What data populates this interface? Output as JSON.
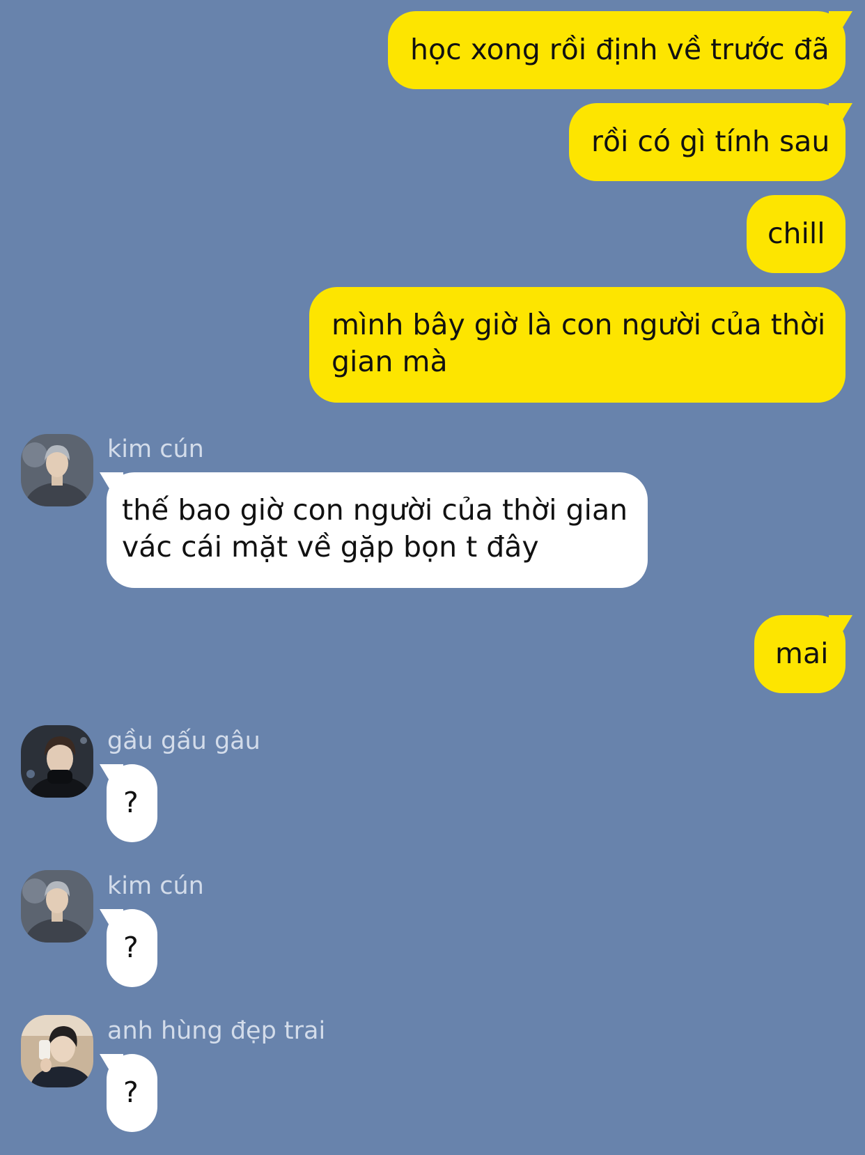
{
  "colors": {
    "background": "#6883ac",
    "outgoing_bubble": "#fde500",
    "incoming_bubble": "#ffffff",
    "sender_name": "#d3dcea"
  },
  "outgoing": [
    {
      "lines": [
        "học xong rồi định về trước đã"
      ]
    },
    {
      "lines": [
        "rồi có gì tính sau"
      ]
    },
    {
      "lines": [
        "chill"
      ]
    },
    {
      "lines": [
        "mình bây giờ là con người của thời",
        "gian mà"
      ]
    },
    {
      "lines": [
        "mai"
      ]
    }
  ],
  "incoming": [
    {
      "sender": "kim cún",
      "avatar_icon": "avatar-photo-icon",
      "lines": [
        "thế bao giờ con người của thời gian",
        "vác cái mặt về gặp bọn t đây"
      ]
    },
    {
      "sender": "gầu gấu gâu",
      "avatar_icon": "avatar-photo-icon",
      "lines": [
        "?"
      ]
    },
    {
      "sender": "kim cún",
      "avatar_icon": "avatar-photo-icon",
      "lines": [
        "?"
      ]
    },
    {
      "sender": "anh hùng đẹp trai",
      "avatar_icon": "avatar-photo-icon",
      "lines": [
        "?"
      ]
    }
  ]
}
